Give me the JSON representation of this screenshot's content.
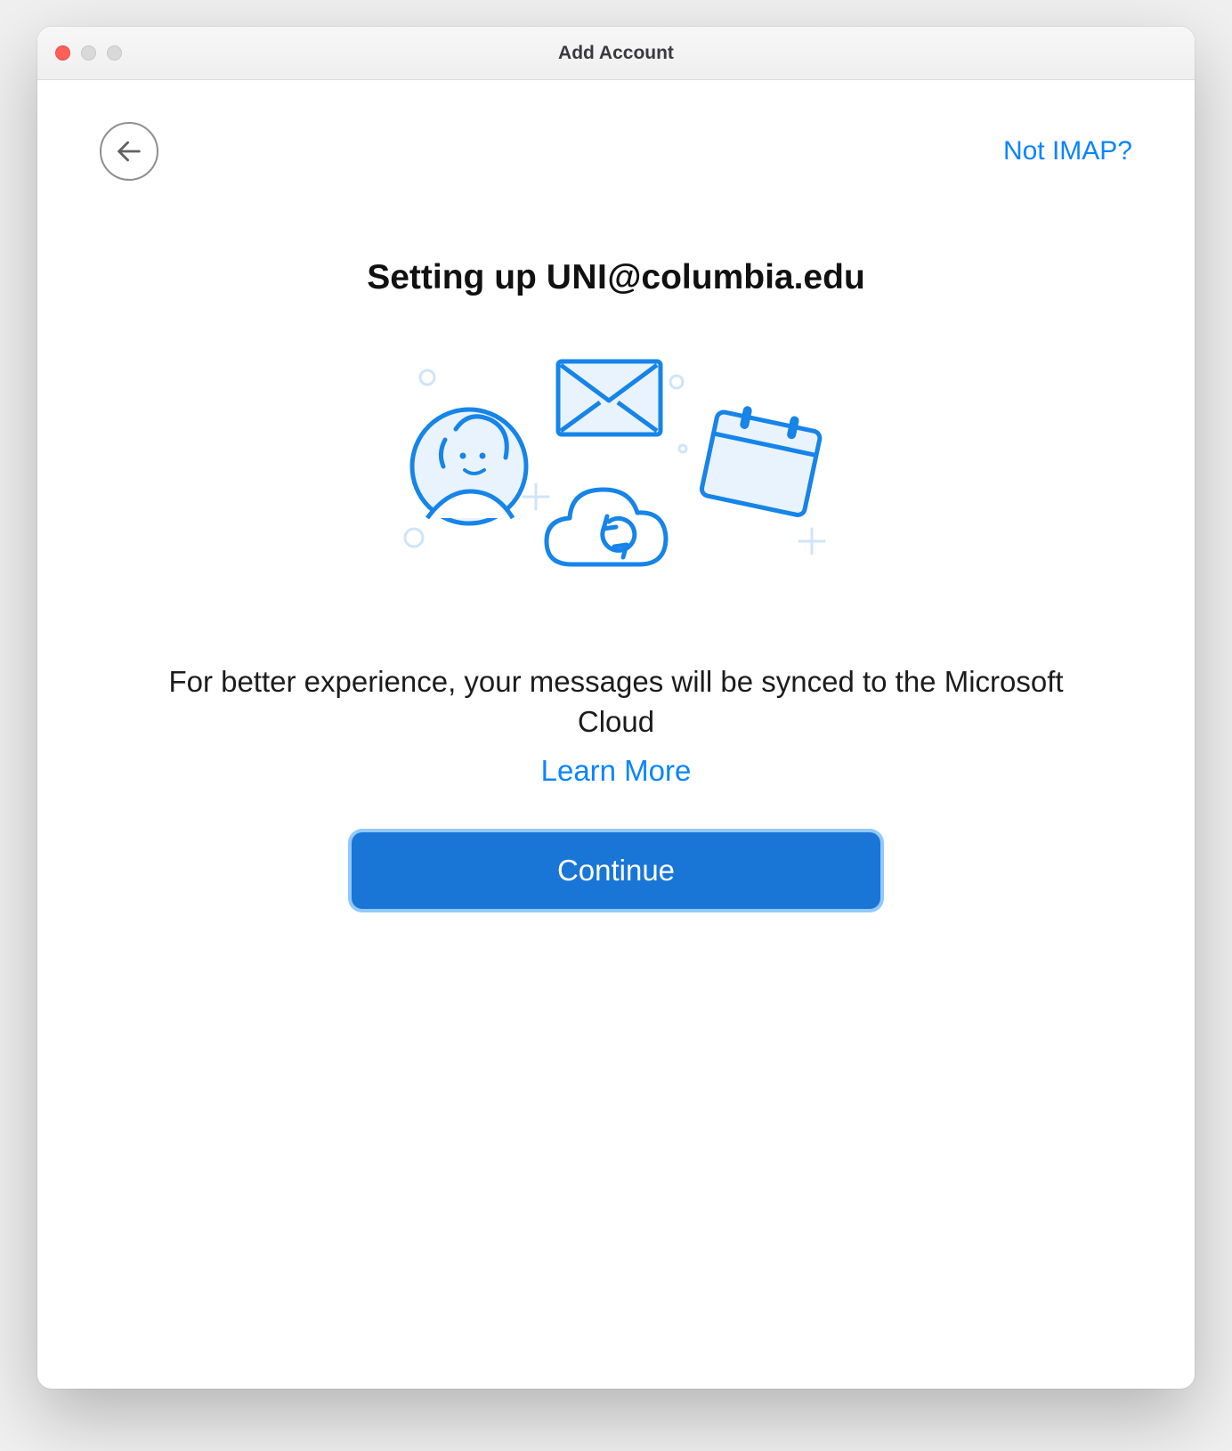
{
  "window": {
    "title": "Add Account"
  },
  "topbar": {
    "not_imap": "Not IMAP?"
  },
  "heading": {
    "prefix": "Setting up ",
    "uni": "UNI",
    "suffix": "@columbia.edu"
  },
  "description": "For better experience, your messages will be synced to the Microsoft Cloud",
  "learn_more": "Learn More",
  "continue": "Continue"
}
